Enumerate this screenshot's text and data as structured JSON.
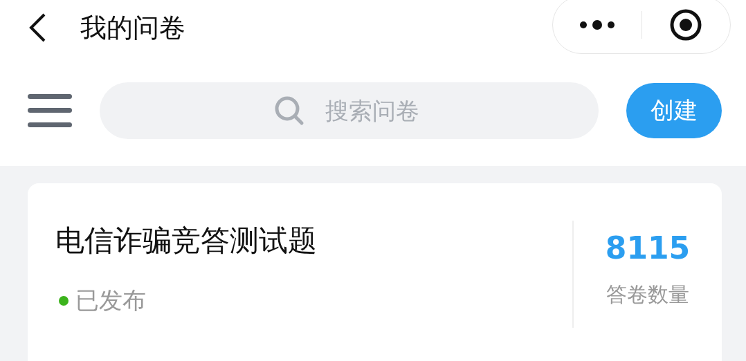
{
  "header": {
    "title": "我的问卷"
  },
  "toolbar": {
    "search": {
      "placeholder": "搜索问卷"
    },
    "create_button": "创建"
  },
  "surveys": [
    {
      "title": "电信诈骗竞答测试题",
      "status": "已发布",
      "color": "#3cb31c",
      "count": "8115",
      "count_label": "答卷数量"
    }
  ]
}
